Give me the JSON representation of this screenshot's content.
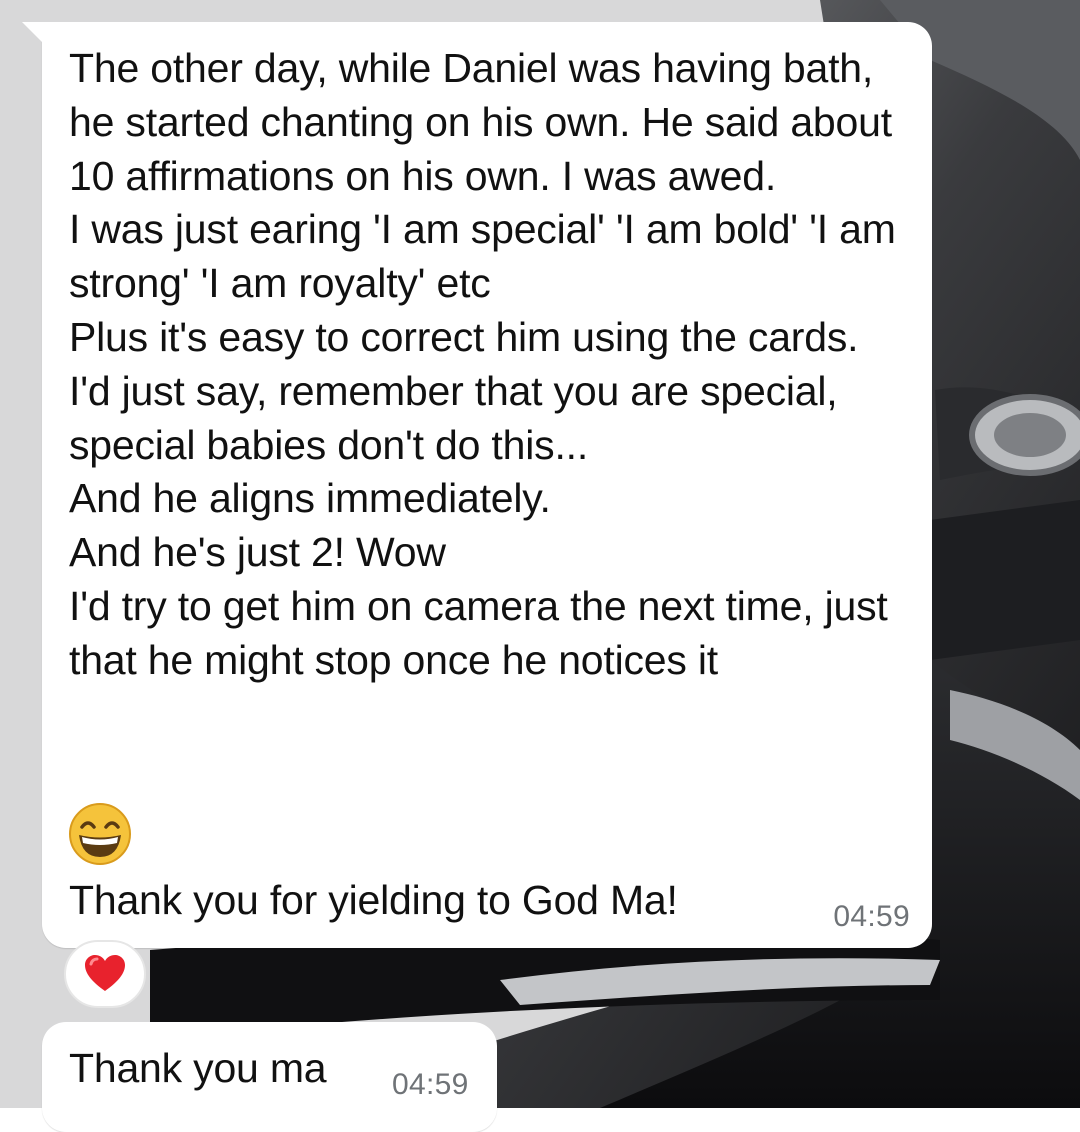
{
  "messages": [
    {
      "text": "The other day, while Daniel was having bath, he started chanting on his own. He said about 10 affirmations on his own. I was awed.\nI was just earing 'I am special' 'I am bold' 'I am strong' 'I am royalty' etc\nPlus it's easy to correct him using the cards.\nI'd just say, remember that you are special, special babies don't do this...\nAnd he aligns immediately.\nAnd he's just 2! Wow\nI'd try to get him on camera the next time, just that he might stop once he notices it",
      "emoji": "grinning-face-with-smiling-eyes",
      "last_line": "Thank you for yielding to God Ma!",
      "time": "04:59",
      "reaction": "red-heart"
    },
    {
      "text": "Thank you ma",
      "time": "04:59"
    }
  ],
  "colors": {
    "bubble": "#ffffff",
    "text": "#111111",
    "timestamp": "#6f7377",
    "heart": "#e8222d",
    "emoji_face": "#f5c33b"
  }
}
